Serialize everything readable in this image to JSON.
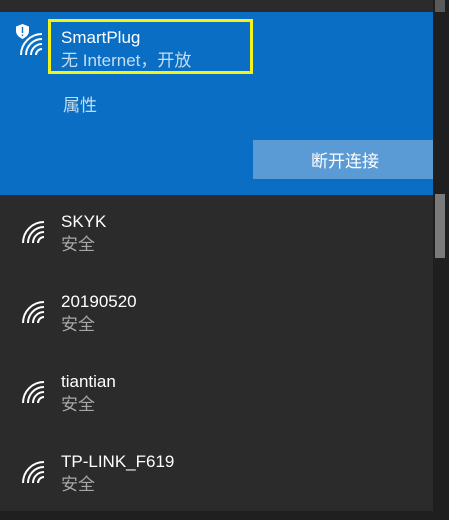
{
  "connected_network": {
    "ssid": "SmartPlug",
    "status": "无 Internet，开放",
    "properties_label": "属性",
    "disconnect_label": "断开连接",
    "icon": "wifi-warning-icon",
    "background_color": "#0a6fc4"
  },
  "networks": [
    {
      "ssid": "SKYK",
      "status": "安全",
      "icon": "wifi-icon"
    },
    {
      "ssid": "20190520",
      "status": "安全",
      "icon": "wifi-icon"
    },
    {
      "ssid": "tiantian",
      "status": "安全",
      "icon": "wifi-icon"
    },
    {
      "ssid": "TP-LINK_F619",
      "status": "安全",
      "icon": "wifi-icon"
    }
  ],
  "colors": {
    "highlight_box": "#f3f31a",
    "disconnect_button": "#5b9bd5",
    "list_background": "#2b2b2b"
  }
}
